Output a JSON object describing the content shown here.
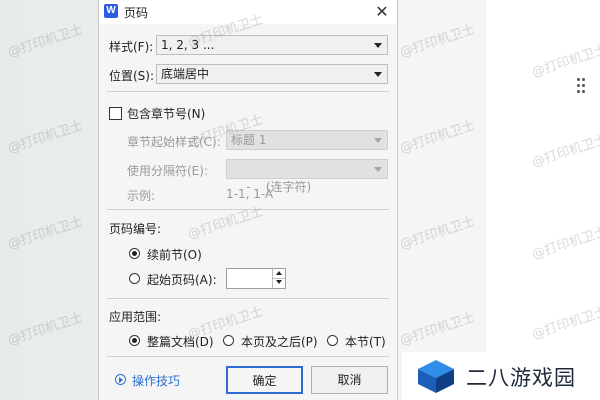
{
  "dialog": {
    "title": "页码",
    "app_icon_letter": "W",
    "style": {
      "label": "样式(F):",
      "value": "1, 2, 3 ..."
    },
    "position": {
      "label": "位置(S):",
      "value": "底端居中"
    },
    "include_chapter": {
      "label": "包含章节号(N)",
      "checked": false
    },
    "chapter_start_style": {
      "label": "章节起始样式(C):",
      "value": "标题 1"
    },
    "separator": {
      "label": "使用分隔符(E):",
      "value": "-    (连字符)"
    },
    "example": {
      "label": "示例:",
      "value": "1-1, 1-A"
    },
    "numbering": {
      "header": "页码编号:",
      "continue": {
        "label": "续前节(O)",
        "selected": true
      },
      "start_at": {
        "label": "起始页码(A):",
        "selected": false,
        "value": ""
      }
    },
    "apply": {
      "header": "应用范围:",
      "options": [
        {
          "label": "整篇文档(D)",
          "selected": true
        },
        {
          "label": "本页及之后(P)",
          "selected": false
        },
        {
          "label": "本节(T)",
          "selected": false
        }
      ]
    },
    "help_link": "操作技巧",
    "ok_label": "确定",
    "cancel_label": "取消"
  },
  "watermark_text": "@打印机卫士",
  "brand_text": "二八游戏园",
  "colors": {
    "accent": "#2b6fd6",
    "app_icon": "#2b5ce6"
  }
}
